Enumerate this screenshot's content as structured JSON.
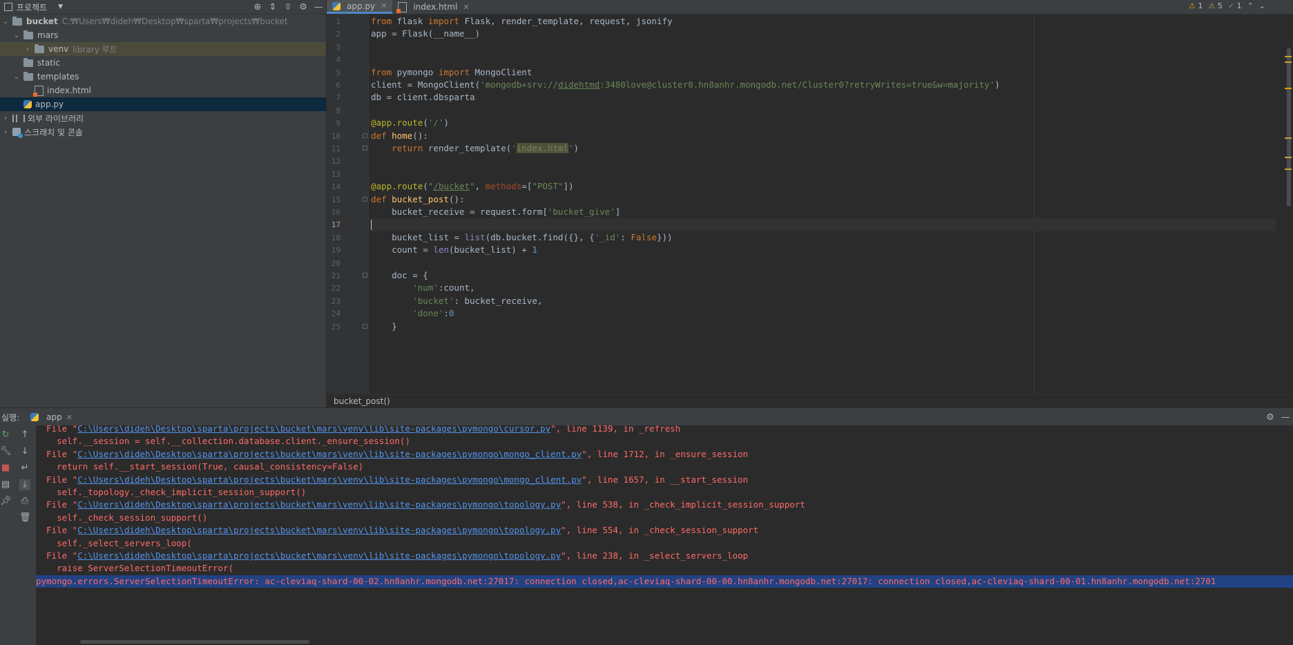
{
  "project": {
    "title": "프로젝트",
    "tree": [
      {
        "label": "bucket",
        "path": "C:₩Users₩dideh₩Desktop₩sparta₩projects₩bucket",
        "depth": 0,
        "chev": "⌄",
        "icon": "folder",
        "bold": true
      },
      {
        "label": "mars",
        "depth": 1,
        "chev": "⌄",
        "icon": "folder"
      },
      {
        "label": "venv",
        "hint": "library 루트",
        "depth": 2,
        "chev": "›",
        "icon": "folder",
        "highlight": true
      },
      {
        "label": "static",
        "depth": 1,
        "chev": "",
        "icon": "folder"
      },
      {
        "label": "templates",
        "depth": 1,
        "chev": "⌄",
        "icon": "folder"
      },
      {
        "label": "index.html",
        "depth": 2,
        "chev": "",
        "icon": "html"
      },
      {
        "label": "app.py",
        "depth": 1,
        "chev": "",
        "icon": "py",
        "selected": true
      },
      {
        "label": "외부 라이브러리",
        "depth": 0,
        "chev": "›",
        "icon": "lib"
      },
      {
        "label": "스크래치 및 콘솔",
        "depth": 0,
        "chev": "›",
        "icon": "scratch"
      }
    ]
  },
  "editor": {
    "tabs": [
      {
        "label": "app.py",
        "active": true
      },
      {
        "label": "index.html",
        "active": false
      }
    ],
    "inspections": {
      "errors": "1",
      "warnings": "5",
      "weak": "1"
    },
    "breadcrumb": "bucket_post()",
    "lines": [
      "<span class='kw'>from</span> flask <span class='kw'>import</span> Flask, render_template, request, jsonify",
      "app = Flask(__name__)",
      "",
      "",
      "<span class='kw'>from</span> pymongo <span class='kw'>import</span> MongoClient",
      "client = MongoClient(<span class='str'>'mongodb+srv://<span class='ul'>didehtmd</span>:3480love@cluster0.hn8anhr.mongodb.net/Cluster0?retryWrites=true&amp;w=majority'</span>)",
      "db = client.dbsparta",
      "",
      "<span class='deco'>@app.route</span>(<span class='str'>'/'</span>)",
      "<span class='kw'>def</span> <span class='fn'>home</span>():",
      "    <span class='kw'>return</span> render_template(<span class='str'>'<span class='hl-str'>index.html</span>'</span>)",
      "",
      "",
      "<span class='deco'>@app.route</span>(<span class='str'>\"<span class='ul'>/bucket</span>\"</span>, <span class='par'>methods</span>=[<span class='str'>\"POST\"</span>])",
      "<span class='kw'>def</span> <span class='fn'>bucket_post</span>():",
      "    bucket_receive = request.form[<span class='str'>'bucket_give'</span>]",
      "",
      "    bucket_list = <span class='bi'>list</span>(db.bucket.find({}, {<span class='str'>'_id'</span>: <span class='kw'>False</span>}))",
      "    count = <span class='bi'>len</span>(bucket_list) + <span class='num'>1</span>",
      "",
      "    doc = {",
      "        <span class='str'>'num'</span>:count,",
      "        <span class='str'>'bucket'</span>: bucket_receive,",
      "        <span class='str'>'done'</span>:<span class='num'>0</span>",
      "    }"
    ]
  },
  "run": {
    "label": "실행:",
    "tab": "app",
    "console": [
      {
        "pre": "  File \"",
        "link": "C:\\Users\\dideh\\Desktop\\sparta\\projects\\bucket\\mars\\venv\\lib\\site-packages\\pymongo\\cursor.py",
        "post": "\", line 1139, in _refresh"
      },
      {
        "pre": "    self.__session = self.__collection.database.client._ensure_session()",
        "link": "",
        "post": ""
      },
      {
        "pre": "  File \"",
        "link": "C:\\Users\\dideh\\Desktop\\sparta\\projects\\bucket\\mars\\venv\\lib\\site-packages\\pymongo\\mongo_client.py",
        "post": "\", line 1712, in _ensure_session"
      },
      {
        "pre": "    return self.__start_session(True, causal_consistency=False)",
        "link": "",
        "post": ""
      },
      {
        "pre": "  File \"",
        "link": "C:\\Users\\dideh\\Desktop\\sparta\\projects\\bucket\\mars\\venv\\lib\\site-packages\\pymongo\\mongo_client.py",
        "post": "\", line 1657, in __start_session"
      },
      {
        "pre": "    self._topology._check_implicit_session_support()",
        "link": "",
        "post": ""
      },
      {
        "pre": "  File \"",
        "link": "C:\\Users\\dideh\\Desktop\\sparta\\projects\\bucket\\mars\\venv\\lib\\site-packages\\pymongo\\topology.py",
        "post": "\", line 538, in _check_implicit_session_support"
      },
      {
        "pre": "    self._check_session_support()",
        "link": "",
        "post": ""
      },
      {
        "pre": "  File \"",
        "link": "C:\\Users\\dideh\\Desktop\\sparta\\projects\\bucket\\mars\\venv\\lib\\site-packages\\pymongo\\topology.py",
        "post": "\", line 554, in _check_session_support"
      },
      {
        "pre": "    self._select_servers_loop(",
        "link": "",
        "post": ""
      },
      {
        "pre": "  File \"",
        "link": "C:\\Users\\dideh\\Desktop\\sparta\\projects\\bucket\\mars\\venv\\lib\\site-packages\\pymongo\\topology.py",
        "post": "\", line 238, in _select_servers_loop"
      },
      {
        "pre": "    raise ServerSelectionTimeoutError(",
        "link": "",
        "post": ""
      },
      {
        "pre": "pymongo.errors.ServerSelectionTimeoutError: ac-cleviaq-shard-00-02.hn8anhr.mongodb.net:27017: connection closed,ac-cleviaq-shard-00-00.hn8anhr.mongodb.net:27017: connection closed,ac-cleviaq-shard-00-01.hn8anhr.mongodb.net:2701",
        "link": "",
        "post": "",
        "error": true
      }
    ]
  }
}
